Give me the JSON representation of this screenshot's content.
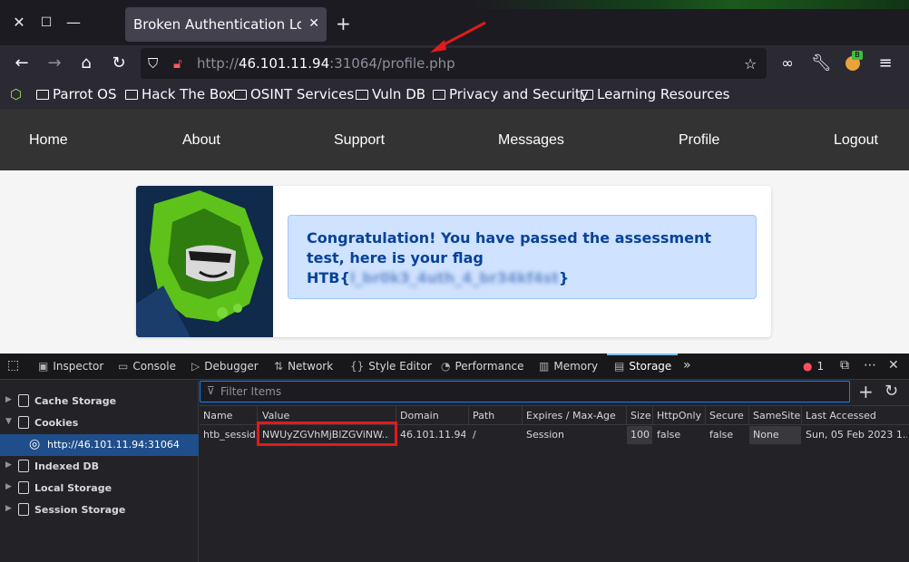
{
  "browser": {
    "tab_title": "Broken Authentication Login",
    "url_scheme_prefix": "http://",
    "url_host": "46.101.11.94",
    "url_rest": ":31064/profile.php",
    "bookmarks": [
      "Parrot OS",
      "Hack The Box",
      "OSINT Services",
      "Vuln DB",
      "Privacy and Security",
      "Learning Resources"
    ]
  },
  "site": {
    "nav": [
      "Home",
      "About",
      "Support",
      "Messages",
      "Profile",
      "Logout"
    ],
    "alert_line1": "Congratulation! You have passed the assessment",
    "alert_line2": "test, here is your flag",
    "flag_prefix": "HTB{",
    "flag_hidden": "l_br0k3_4uth_4_br34kf4st",
    "flag_suffix": "}"
  },
  "devtools": {
    "tabs": [
      "Inspector",
      "Console",
      "Debugger",
      "Network",
      "Style Editor",
      "Performance",
      "Memory",
      "Storage"
    ],
    "active_tab": "Storage",
    "error_count": "1",
    "filter_placeholder": "Filter Items",
    "tree": [
      "Cache Storage",
      "Cookies",
      "http://46.101.11.94:31064",
      "Indexed DB",
      "Local Storage",
      "Session Storage"
    ],
    "columns": [
      "Name",
      "Value",
      "Domain",
      "Path",
      "Expires / Max-Age",
      "Size",
      "HttpOnly",
      "Secure",
      "SameSite",
      "Last Accessed"
    ],
    "cookie": {
      "name": "htb_sessid",
      "value": "NWUyZGVhMjBlZGViNW...",
      "domain": "46.101.11.94",
      "path": "/",
      "expires": "Session",
      "size": "100",
      "httponly": "false",
      "secure": "false",
      "samesite": "None",
      "last_accessed": "Sun, 05 Feb 2023 1..."
    }
  },
  "colors": {
    "accent": "#0a84ff",
    "highlight_box": "#e01b1b",
    "alert_bg": "#cfe2ff"
  }
}
